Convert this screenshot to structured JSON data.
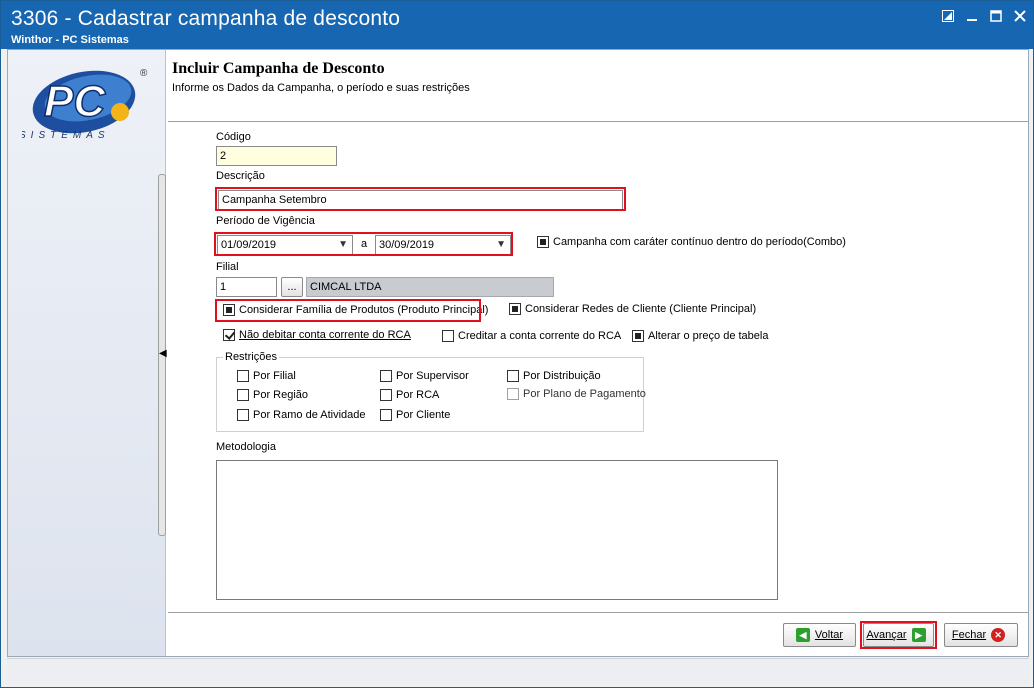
{
  "window": {
    "title": "3306 - Cadastrar campanha de desconto",
    "subtitle": "Winthor - PC Sistemas"
  },
  "logo": {
    "text": "PC",
    "tagline": "SISTEMAS",
    "mark": "®"
  },
  "header": {
    "title": "Incluir Campanha de Desconto",
    "subtitle": "Informe os Dados da Campanha, o período e suas restrições"
  },
  "form": {
    "codigo_label": "Código",
    "codigo_value": "2",
    "descricao_label": "Descrição",
    "descricao_value": "Campanha Setembro",
    "periodo_label": "Período de Vigência",
    "periodo_inicio": "01/09/2019",
    "periodo_sep": "a",
    "periodo_fim": "30/09/2019",
    "combo_check": "Campanha com caráter contínuo dentro do período(Combo)",
    "filial_label": "Filial",
    "filial_code": "1",
    "filial_btn": "...",
    "filial_name": "CIMCAL LTDA",
    "familia_check": "Considerar Família de Produtos (Produto Principal)",
    "redes_check": "Considerar Redes de Cliente (Cliente Principal)",
    "nao_debitar_check": "Não debitar conta corrente do RCA",
    "creditar_check": "Creditar a conta corrente do RCA",
    "alterar_check": "Alterar o preço de tabela",
    "restricoes_label": "Restrições",
    "restricoes": {
      "por_filial": "Por Filial",
      "por_regiao": "Por Região",
      "por_ramo": "Por Ramo de Atividade",
      "por_supervisor": "Por Supervisor",
      "por_rca": "Por RCA",
      "por_cliente": "Por Cliente",
      "por_distribuicao": "Por Distribuição",
      "por_plano": "Por Plano de Pagamento"
    },
    "metodologia_label": "Metodologia"
  },
  "buttons": {
    "voltar": "Voltar",
    "avancar": "Avançar",
    "fechar": "Fechar"
  }
}
